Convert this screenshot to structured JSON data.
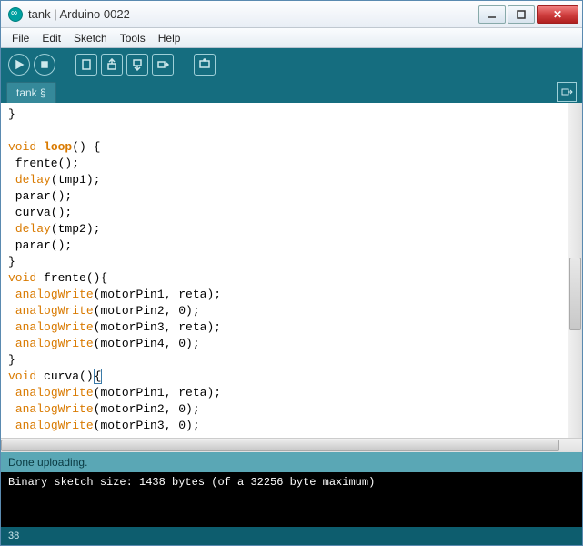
{
  "window": {
    "title": "tank | Arduino 0022",
    "minimize_tip": "Minimize",
    "maximize_tip": "Maximize",
    "close_tip": "Close"
  },
  "menu": {
    "file": "File",
    "edit": "Edit",
    "sketch": "Sketch",
    "tools": "Tools",
    "help": "Help"
  },
  "toolbar": {
    "run": "Verify",
    "stop": "Stop",
    "new": "New",
    "open": "Open",
    "save": "Save",
    "upload": "Upload",
    "serial": "Serial Monitor"
  },
  "tabs": {
    "current": "tank §",
    "menu_tip": "Tab menu"
  },
  "code": {
    "l1": "}",
    "l2": "",
    "l3a": "void",
    "l3b": "loop",
    "l3c": "() {",
    "l4a": " frente();",
    "l5a": " ",
    "l5b": "delay",
    "l5c": "(tmp1);",
    "l6a": " parar();",
    "l7a": " curva();",
    "l8a": " ",
    "l8b": "delay",
    "l8c": "(tmp2);",
    "l9a": " parar();",
    "l10": "}",
    "l11a": "void",
    "l11b": " frente(){",
    "l12a": " ",
    "l12b": "analogWrite",
    "l12c": "(motorPin1, reta);",
    "l13a": " ",
    "l13b": "analogWrite",
    "l13c": "(motorPin2, 0);",
    "l14a": " ",
    "l14b": "analogWrite",
    "l14c": "(motorPin3, reta);",
    "l15a": " ",
    "l15b": "analogWrite",
    "l15c": "(motorPin4, 0);",
    "l16": "}",
    "l17a": "void",
    "l17b": " curva()",
    "l17c": "{",
    "l18a": " ",
    "l18b": "analogWrite",
    "l18c": "(motorPin1, reta);",
    "l19a": " ",
    "l19b": "analogWrite",
    "l19c": "(motorPin2, 0);",
    "l20a": " ",
    "l20b": "analogWrite",
    "l20c": "(motorPin3, 0);"
  },
  "status": {
    "message": "Done uploading."
  },
  "console": {
    "line1": "Binary sketch size: 1438 bytes (of a 32256 byte maximum)"
  },
  "footer": {
    "line": "38"
  }
}
